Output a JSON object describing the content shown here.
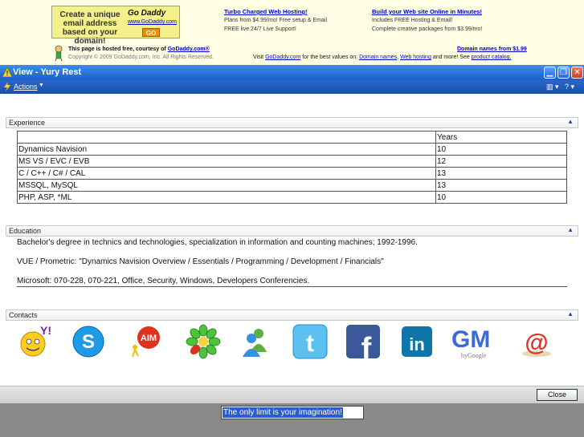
{
  "ad": {
    "box_text": "Create a unique email address based on your domain!",
    "box_logo": "Go Daddy",
    "box_url": "www.GoDaddy.com",
    "box_go": "GO",
    "col1_head": "Turbo Charged Web Hosting!",
    "col1_line1": "Plans from $4.99/mo! Free setup & Email",
    "col1_line2": "FREE live 24/7 Live Support!",
    "col2_head": "Build your Web site Online in Minutes!",
    "col2_line1": "Includes FREE Hosting & Email!",
    "col2_line2": "Complete creative packages from $3.99/mo!",
    "hosted_prefix": "This page is hosted free, courtesy of",
    "hosted_link": "GoDaddy.com®",
    "copyright": "Copyright © 2009 GoDaddy.com, Inc. All Rights Reserved.",
    "domain_price": "Domain names from $1.99",
    "visit_prefix": "Visit",
    "visit_link": "GoDaddy.com",
    "visit_mid": "for the best values on:",
    "visit_l1": "Domain names",
    "visit_l2": "Web hosting",
    "visit_mid2": "and more! See",
    "visit_l3": "product catalog."
  },
  "window": {
    "title": "View - Yury Rest",
    "min": "▁",
    "max": "❐",
    "close": "✕"
  },
  "toolbar": {
    "actions_label": "Actions",
    "actions_caret": "▼",
    "view_label": "▥ ▾",
    "help_label": "? ▾"
  },
  "sections": {
    "experience": {
      "label": "Experience",
      "toggle": "▲",
      "header": [
        "",
        "Years"
      ],
      "rows": [
        [
          "Dynamics Navision",
          "10"
        ],
        [
          "MS VS / EVC / EVB",
          "12"
        ],
        [
          "C / C++ / C# / CAL",
          "13"
        ],
        [
          "MSSQL, MySQL",
          "13"
        ],
        [
          "PHP, ASP, *ML",
          "10"
        ]
      ]
    },
    "education": {
      "label": "Education",
      "toggle": "▲",
      "line1": "Bachelor's degree in technics and technologies, specialization in information and counting machines; 1992-1996.",
      "line2": "VUE / Prometric: \"Dynamics Navision Overview / Essentials / Programming / Development / Financials\"",
      "line3": "Microsoft: 070-228, 070-221, Office, Security, Windows, Developers Conferencies."
    },
    "contacts": {
      "label": "Contacts",
      "toggle": "▲",
      "icons": [
        "yahoo-messenger-icon",
        "skype-icon",
        "aim-icon",
        "icq-icon",
        "msn-messenger-icon",
        "twitter-icon",
        "facebook-icon",
        "linkedin-icon",
        "gmail-icon",
        "email-icon"
      ],
      "aim_text": "AIM",
      "twitter_text": "t",
      "facebook_text": "f",
      "linkedin_text": "in",
      "gmail_text": "GM",
      "gmail_sub": "byGoogle",
      "email_text": "@",
      "skype_text": "S",
      "yahoo_text": "Y!"
    }
  },
  "footer": {
    "close_label": "Close",
    "status_text": "The only limit is your imagination!"
  },
  "colors": {
    "titlebar": "#1c5fc9",
    "toolbar": "#1b4fa8",
    "status_bg": "#898989",
    "ad_bg": "#ffffe6"
  }
}
